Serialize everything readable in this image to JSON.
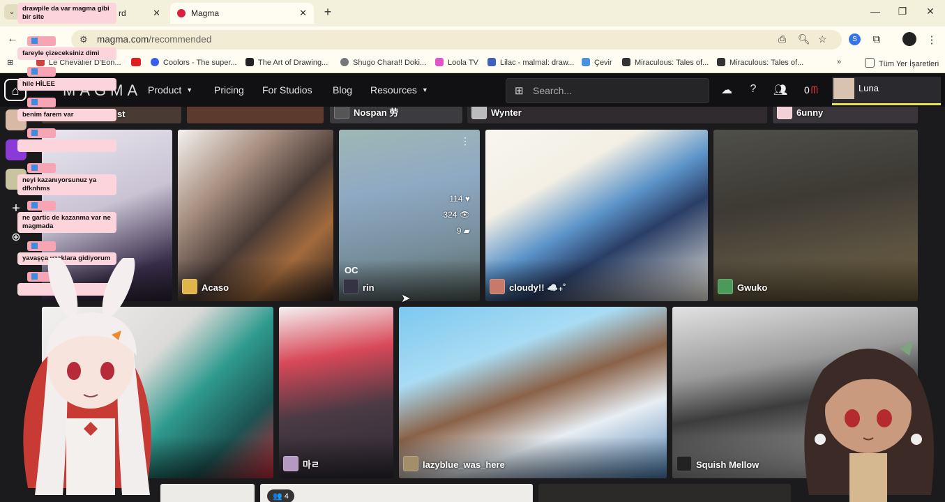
{
  "browser": {
    "tabs": [
      {
        "title": "rd",
        "active": false
      },
      {
        "title": "Magma",
        "active": true
      }
    ],
    "url_host": "magma.com",
    "url_path": "/recommended",
    "bookmarks": [
      {
        "label": "Le Chevalier D'Eon...",
        "color": "#c44"
      },
      {
        "label": "",
        "color": "#e02020"
      },
      {
        "label": "Coolors - The super...",
        "color": "#3a5ff0"
      },
      {
        "label": "The Art of Drawing...",
        "color": "#222"
      },
      {
        "label": "Shugo Chara!! Doki...",
        "color": "#777"
      },
      {
        "label": "Loola TV",
        "color": "#e254c8"
      },
      {
        "label": "Lilac - malmal: draw...",
        "color": "#4060c0"
      },
      {
        "label": "Çevir",
        "color": "#4a90e2"
      },
      {
        "label": "Miraculous: Tales of...",
        "color": "#333"
      },
      {
        "label": "Miraculous: Tales of...",
        "color": "#333"
      }
    ],
    "all_bookmarks": "Tüm Yer İşaretleri"
  },
  "magma": {
    "logo": "MAGMA",
    "nav": [
      {
        "label": "Product",
        "dropdown": true
      },
      {
        "label": "Pricing",
        "dropdown": false
      },
      {
        "label": "For Studios",
        "dropdown": false
      },
      {
        "label": "Blog",
        "dropdown": false
      },
      {
        "label": "Resources",
        "dropdown": true
      }
    ],
    "search_placeholder": "Search...",
    "count": "0",
    "username": "Luna"
  },
  "gallery": {
    "top_row": [
      "st",
      "Nospan 劳",
      "Wynter",
      "6unny"
    ],
    "row1": [
      {
        "artist": ""
      },
      {
        "artist": "Acaso"
      },
      {
        "artist": "rin",
        "title": "OC",
        "likes": "114",
        "views": "324",
        "comments": "9"
      },
      {
        "artist": "cloudy!! ☁️₊˚"
      },
      {
        "artist": "Gwuko"
      }
    ],
    "row2": [
      {
        "artist": ""
      },
      {
        "artist": "마ㄹ"
      },
      {
        "artist": "lazyblue_was_here"
      },
      {
        "artist": "Squish Mellow"
      }
    ],
    "row3_badge": "4"
  },
  "chat": [
    {
      "text": "drawpile da var magma gibi bir site"
    },
    {
      "text": "fareyle çizeceksiniz dimi"
    },
    {
      "text": "hile HİLEE"
    },
    {
      "text": "benim farem var"
    },
    {
      "text": ""
    },
    {
      "text": "neyi kazanıyorsunuz ya dfknhms"
    },
    {
      "text": "ne gartic de kazanma var ne magmada"
    },
    {
      "text": "yavaşça uzaklara gidiyorum"
    },
    {
      "text": ""
    }
  ]
}
